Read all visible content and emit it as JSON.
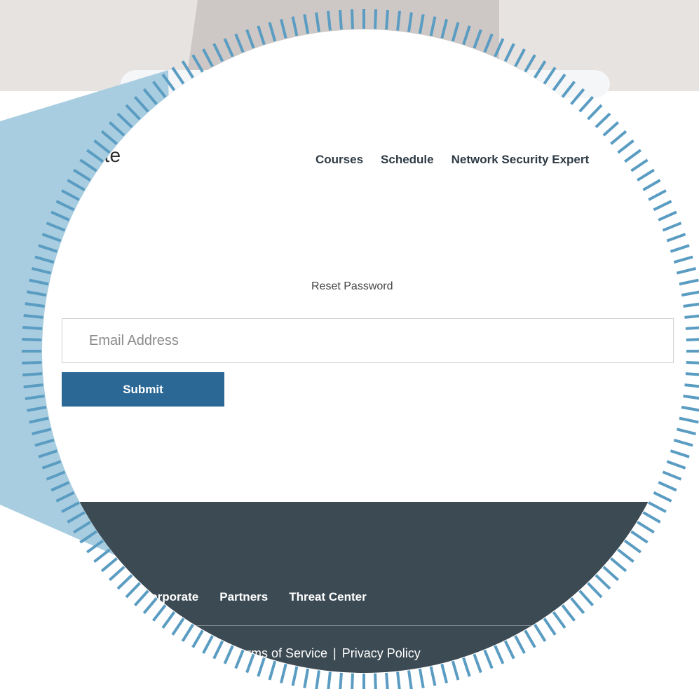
{
  "header": {
    "brand_fragment": "itute",
    "nav": [
      {
        "label": "Courses"
      },
      {
        "label": "Schedule"
      },
      {
        "label": "Network Security Expert"
      }
    ]
  },
  "main": {
    "title": "Reset Password",
    "email_placeholder": "Email Address",
    "submit_label": "Submit"
  },
  "footer": {
    "links": [
      {
        "label": "Corporate"
      },
      {
        "label": "Partners"
      },
      {
        "label": "Threat Center"
      }
    ],
    "legal_left": "Terms of Service",
    "separator": "|",
    "legal_right": "Privacy Policy"
  },
  "colors": {
    "accent": "#2c6896",
    "footer_bg": "#3c4a53",
    "lens_ring": "#5a9cc2",
    "callout": "#a8cde0",
    "backdrop": "#e6e3e1"
  }
}
